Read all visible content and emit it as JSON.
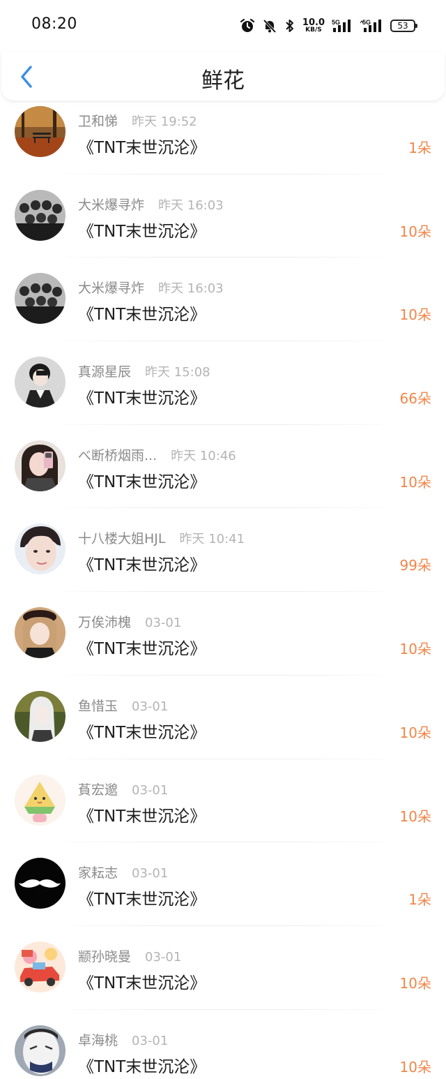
{
  "status_bar": {
    "time": "08:20",
    "net_speed_value": "10.0",
    "net_speed_unit": "KB/S",
    "signal_1_label": "5G",
    "signal_2_label": "5G",
    "battery": "53"
  },
  "header": {
    "title": "鲜花",
    "back_icon": "chevron-left-icon"
  },
  "colors": {
    "accent": "#3a8ee6",
    "count": "#f0864a",
    "name": "#8a8a8a",
    "time": "#b4b4b4"
  },
  "rows": [
    {
      "name": "卫和悌",
      "time": "昨天 19:52",
      "title": "《TNT末世沉沦》",
      "count": "1朵",
      "avatar": "autumn-bench"
    },
    {
      "name": "大米爆寻炸",
      "time": "昨天 16:03",
      "title": "《TNT末世沉沦》",
      "count": "10朵",
      "avatar": "group-photo"
    },
    {
      "name": "大米爆寻炸",
      "time": "昨天 16:03",
      "title": "《TNT末世沉沦》",
      "count": "10朵",
      "avatar": "group-photo"
    },
    {
      "name": "真源星辰",
      "time": "昨天 15:08",
      "title": "《TNT末世沉沦》",
      "count": "66朵",
      "avatar": "boy-portrait"
    },
    {
      "name": "べ断桥烟雨...",
      "time": "昨天 10:46",
      "title": "《TNT末世沉沦》",
      "count": "10朵",
      "avatar": "girl-selfie"
    },
    {
      "name": "十八楼大姐HJL",
      "time": "昨天 10:41",
      "title": "《TNT末世沉沦》",
      "count": "99朵",
      "avatar": "boy-closeup"
    },
    {
      "name": "万俟沛槐",
      "time": "03-01",
      "title": "《TNT末世沉沦》",
      "count": "10朵",
      "avatar": "girl-hat"
    },
    {
      "name": "鱼惜玉",
      "time": "03-01",
      "title": "《TNT末世沉沦》",
      "count": "10朵",
      "avatar": "anime-girl"
    },
    {
      "name": "萯宏邈",
      "time": "03-01",
      "title": "《TNT末世沉沦》",
      "count": "10朵",
      "avatar": "cartoon-rice-dumpling"
    },
    {
      "name": "家耘志",
      "time": "03-01",
      "title": "《TNT末世沉沦》",
      "count": "1朵",
      "avatar": "mustache"
    },
    {
      "name": "颛孙晓曼",
      "time": "03-01",
      "title": "《TNT末世沉沦》",
      "count": "10朵",
      "avatar": "cartoon-car"
    },
    {
      "name": "卓海桃",
      "time": "03-01",
      "title": "《TNT末世沉沦》",
      "count": "10朵",
      "avatar": "clown-face"
    }
  ]
}
